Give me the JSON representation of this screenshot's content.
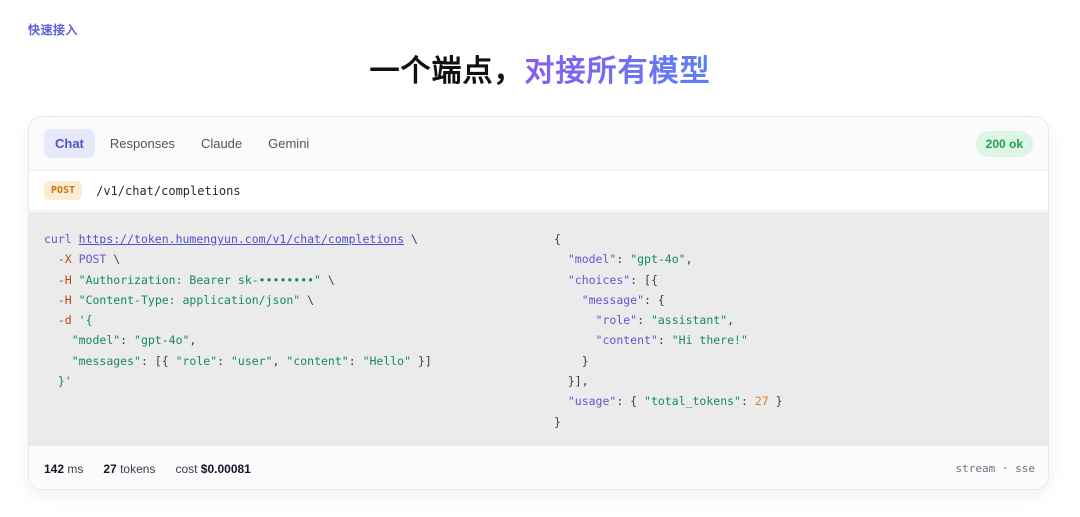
{
  "eyebrow": "快速接入",
  "headline": {
    "part1": "一个端点，",
    "part2": "对接所有模型"
  },
  "tabs": [
    {
      "label": "Chat",
      "active": true
    },
    {
      "label": "Responses",
      "active": false
    },
    {
      "label": "Claude",
      "active": false
    },
    {
      "label": "Gemini",
      "active": false
    }
  ],
  "status_badge": "200 ok",
  "endpoint": {
    "method": "POST",
    "path": "/v1/chat/completions"
  },
  "request": {
    "cmd": "curl",
    "url": "https://token.humengyun.com/v1/chat/completions",
    "cont": " \\",
    "x_flag": "-X",
    "x_value": "POST",
    "h_flag": "-H",
    "h1": "\"Authorization: Bearer sk-••••••••\"",
    "h2": "\"Content-Type: application/json\"",
    "d_flag": "-d",
    "d_open": "'{",
    "model_key": "\"model\"",
    "model_val": "\"gpt-4o\"",
    "messages_key": "\"messages\"",
    "role_key": "\"role\"",
    "role_val": "\"user\"",
    "content_key": "\"content\"",
    "content_val": "\"Hello\"",
    "d_close": "}'"
  },
  "response": {
    "model_key": "\"model\"",
    "model_val": "\"gpt-4o\"",
    "choices_key": "\"choices\"",
    "message_key": "\"message\"",
    "role_key": "\"role\"",
    "role_val": "\"assistant\"",
    "content_key": "\"content\"",
    "content_val": "\"Hi there!\"",
    "usage_key": "\"usage\"",
    "total_tokens_key": "\"total_tokens\"",
    "total_tokens_val": "27"
  },
  "footer": {
    "latency_value": "142",
    "latency_unit": "ms",
    "tokens_value": "27",
    "tokens_unit": "tokens",
    "cost_label": "cost",
    "cost_value": "$0.00081",
    "stream_text": "stream · sse"
  },
  "colors": {
    "accent": "#6b68e0",
    "status_green": "#1f9d55",
    "method_orange": "#c97316"
  }
}
